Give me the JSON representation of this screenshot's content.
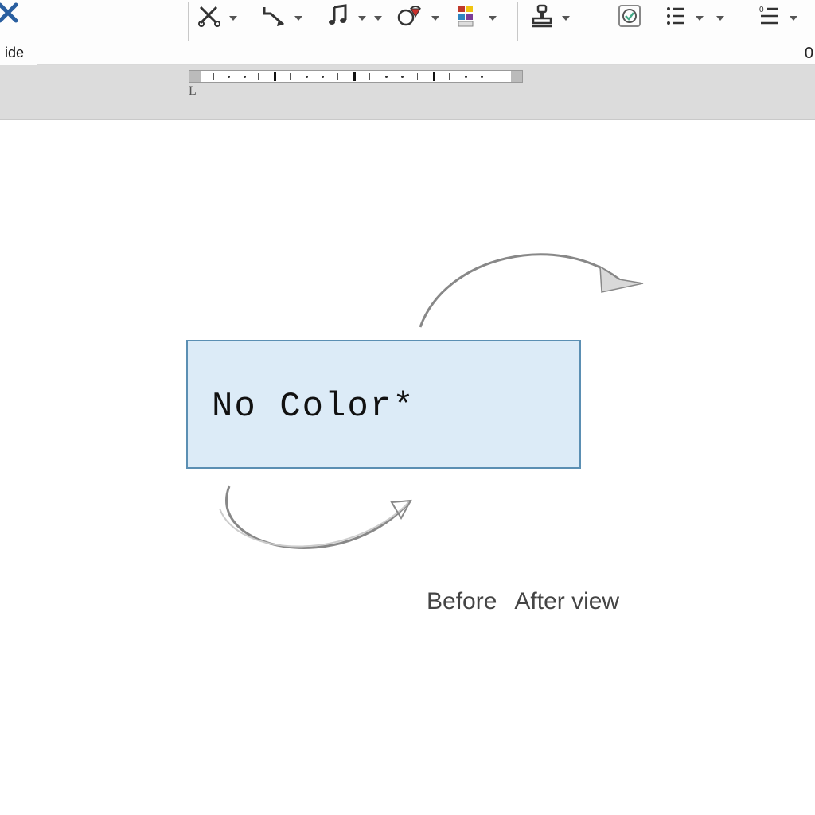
{
  "toolbar": {
    "slide_fragment_label": "ide",
    "right_readout": "0",
    "groups": [
      {
        "id": "cut-icon",
        "name": "cut"
      },
      {
        "id": "connector-icon",
        "name": "connector"
      },
      {
        "id": "music-icon",
        "name": "music-note"
      },
      {
        "id": "shapeset-icon",
        "name": "shape-set"
      },
      {
        "id": "colorgrid-icon",
        "name": "color-grid"
      },
      {
        "id": "stamp-icon",
        "name": "stamp"
      },
      {
        "id": "checklist-icon",
        "name": "task-list"
      },
      {
        "id": "numlist-icon",
        "name": "numbered-list"
      },
      {
        "id": "bullist-icon",
        "name": "bulleted-list"
      }
    ]
  },
  "ruler": {
    "l_mark": "L"
  },
  "slide": {
    "textbox_text": "No Color*",
    "caption_before": "Before",
    "caption_after": "After view"
  }
}
